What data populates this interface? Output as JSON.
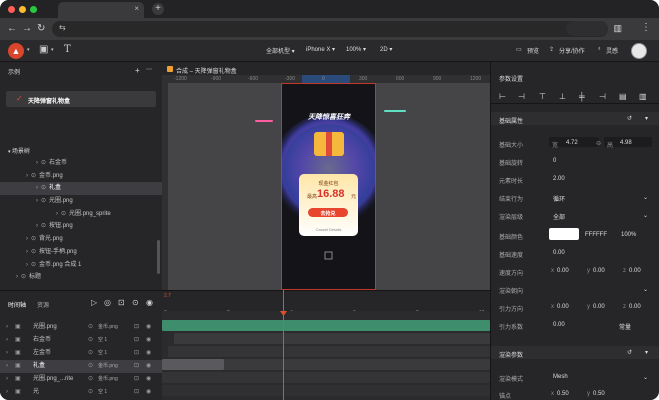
{
  "browser": {
    "tab_title": "",
    "new_tab": "+",
    "close": "×",
    "colors": {
      "red": "#ff5f57",
      "yellow": "#febc2e",
      "green": "#28c840"
    }
  },
  "toolbar": {
    "device": "全部机型 ▾",
    "phone": "iPhone X ▾",
    "zoom": "100% ▾",
    "mode": "2D ▾",
    "preview": "预览",
    "share": "分享/协作",
    "inspiration": "灵感"
  },
  "left": {
    "examples_title": "示例",
    "add": "+",
    "more": "⋯",
    "selected_case": "天降弹窗礼物盒",
    "tree_title": "场景树",
    "tree": [
      {
        "label": "右金币",
        "indent": 30,
        "sel": false
      },
      {
        "label": "金币.png",
        "indent": 20,
        "sel": false
      },
      {
        "label": "礼盒",
        "indent": 30,
        "sel": true
      },
      {
        "label": "光圈.png",
        "indent": 30,
        "sel": false
      },
      {
        "label": "光圈.png_sprite",
        "indent": 50,
        "sel": false
      },
      {
        "label": "按钮.png",
        "indent": 30,
        "sel": false
      },
      {
        "label": "背光.png",
        "indent": 20,
        "sel": false
      },
      {
        "label": "按钮-手柄.png",
        "indent": 20,
        "sel": false
      },
      {
        "label": "金币.png 合成 1",
        "indent": 20,
        "sel": false
      },
      {
        "label": "标题",
        "indent": 10,
        "sel": false
      }
    ]
  },
  "canvas": {
    "tab": "合成 – 天降弹窗礼物盒",
    "ruler": [
      "-1200",
      "-900",
      "-600",
      "-300",
      "0",
      "300",
      "600",
      "900",
      "1200"
    ],
    "popup": {
      "title": "天降惊喜狂奔",
      "card_title": "现金红包",
      "amount_prefix": "最高",
      "amount": "16.88",
      "amount_unit": "元",
      "button": "去抢兑",
      "footer": "Cancel Details"
    }
  },
  "right": {
    "title": "参数设置",
    "basic": "基础属性",
    "size_label": "基础大小",
    "w_label": "宽",
    "w": "4.72",
    "h_label": "高",
    "h": "4.98",
    "rotation_label": "基础旋转",
    "rotation": "0",
    "duration_label": "元素时长",
    "duration": "2.00",
    "end_label": "结束行为",
    "end": "循环",
    "render_label": "渲染层级",
    "render": "全部",
    "color_label": "基础颜色",
    "color_hex": "FFFFFF",
    "opacity": "100%",
    "speed_label": "基础速度",
    "speed": "0.00",
    "vel_label": "速度方向",
    "grav_label": "渲染朝向",
    "force_label": "引力方向",
    "force_x": "0.00",
    "force_y": "0.00",
    "force_z": "0.00",
    "coef_label": "引力系数",
    "coef": "0.00",
    "coef_mode": "常量",
    "render_params": "渲染参数",
    "render_mode_label": "渲染模式",
    "render_mode": "Mesh",
    "anchor_label": "锚点",
    "anchor_x": "0.50",
    "anchor_y": "0.50",
    "x": "x",
    "y": "y",
    "z": "z",
    "val0": "0.00"
  },
  "timeline": {
    "tab1": "时间轴",
    "tab2": "资源",
    "time": "2.7",
    "marks": [
      "0s",
      "2s",
      "4s",
      "6s",
      "8s",
      "10s"
    ],
    "rows": [
      {
        "label": "光圈.png",
        "sub": "金币.png",
        "sel": false
      },
      {
        "label": "右金币",
        "sub": "空 1",
        "sel": false
      },
      {
        "label": "左金币",
        "sub": "空 1",
        "sel": false
      },
      {
        "label": "礼盒",
        "sub": "金币.png",
        "sel": true
      },
      {
        "label": "光圈.png_...rite",
        "sub": "金币.png",
        "sel": false
      },
      {
        "label": "光",
        "sub": "空 1",
        "sel": false
      }
    ]
  }
}
